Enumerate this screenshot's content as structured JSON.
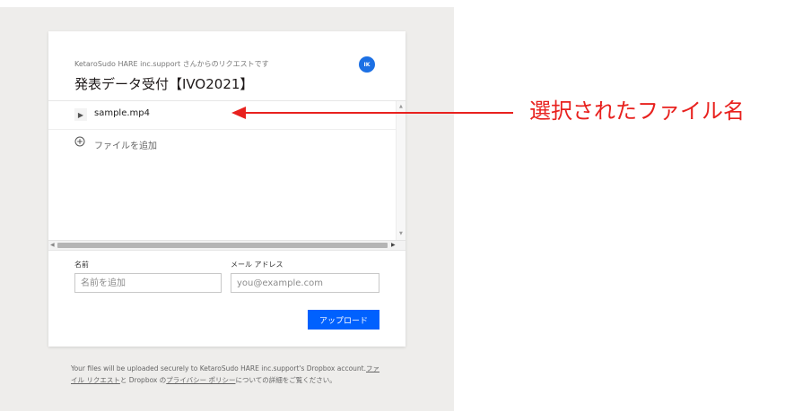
{
  "request": {
    "from_line": "KetaroSudo HARE inc.support さんからのリクエストです",
    "title": "発表データ受付【IVO2021】",
    "avatar_initials": "IK"
  },
  "files": [
    {
      "name": "sample.mp4"
    }
  ],
  "add_file_label": "ファイルを追加",
  "form": {
    "name_label": "名前",
    "name_placeholder": "名前を追加",
    "email_label": "メール アドレス",
    "email_placeholder": "you@example.com",
    "upload_label": "アップロード"
  },
  "footer": {
    "text1": "Your files will be uploaded securely to KetaroSudo HARE inc.support's Dropbox account.",
    "link1": "ファイル リクエスト",
    "text2": "と Dropbox の",
    "link2": "プライバシー ポリシー",
    "text3": "についての詳細をご覧ください。"
  },
  "annotation": {
    "label": "選択されたファイル名"
  },
  "colors": {
    "accent": "#0061fe",
    "avatar": "#1c70e4",
    "annotation": "#e8211e"
  }
}
